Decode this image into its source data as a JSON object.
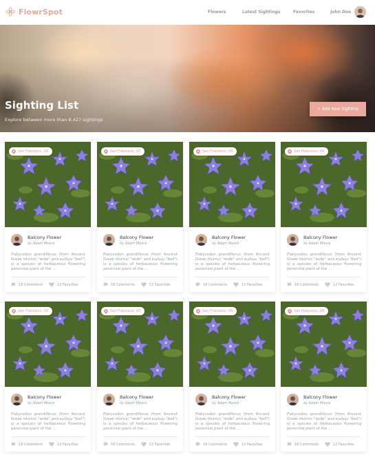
{
  "app": {
    "name": "FlowrSpot",
    "brand_color": "#e8a89a"
  },
  "nav": {
    "flowers": "Flowers",
    "latest_sightings": "Latest Sightings",
    "favorites": "Favorites",
    "user_name": "John Doe"
  },
  "hero": {
    "title": "Sighting List",
    "subtitle": "Explore between more than 8.427 sightings",
    "add_button": "+ Add New Sighting"
  },
  "cards": [
    {
      "location": "San Francisco, US",
      "flower": "Balcony Flower",
      "author": "by Adam Moore",
      "description": "Platycodon grandiflorus (from Ancient Greek πλατύς \"wide\" and κώδων \"bell\") is a species of herbaceous flowering perennial plant of the ...",
      "comments": "18 Comments",
      "favorites": "12 Favorites"
    },
    {
      "location": "San Francisco, US",
      "flower": "Balcony Flower",
      "author": "by Adam Moore",
      "description": "Platycodon grandiflorus (from Ancient Greek πλατύς \"wide\" and κώδων \"bell\") is a species of herbaceous flowering perennial plant of the ...",
      "comments": "18 Comments",
      "favorites": "12 Favorites"
    },
    {
      "location": "San Francisco, US",
      "flower": "Balcony Flower",
      "author": "by Adam Moore",
      "description": "Platycodon grandiflorus (from Ancient Greek πλατύς \"wide\" and κώδων \"bell\") is a species of herbaceous flowering perennial plant of the ...",
      "comments": "18 Comments",
      "favorites": "12 Favorites"
    },
    {
      "location": "San Francisco, US",
      "flower": "Balcony Flower",
      "author": "by Adam Moore",
      "description": "Platycodon grandiflorus (from Ancient Greek πλατύς \"wide\" and κώδων \"bell\") is a species of herbaceous flowering perennial plant of the ...",
      "comments": "18 Comments",
      "favorites": "12 Favorites"
    },
    {
      "location": "San Francisco, US",
      "flower": "Balcony Flower",
      "author": "by Adam Moore",
      "description": "Platycodon grandiflorus (from Ancient Greek πλατύς \"wide\" and κώδων \"bell\") is a species of herbaceous flowering perennial plant of the ...",
      "comments": "18 Comments",
      "favorites": "12 Favorites"
    },
    {
      "location": "San Francisco, US",
      "flower": "Balcony Flower",
      "author": "by Adam Moore",
      "description": "Platycodon grandiflorus (from Ancient Greek πλατύς \"wide\" and κώδων \"bell\") is a species of herbaceous flowering perennial plant of the ...",
      "comments": "18 Comments",
      "favorites": "12 Favorites"
    },
    {
      "location": "San Francisco, US",
      "flower": "Balcony Flower",
      "author": "by Adam Moore",
      "description": "Platycodon grandiflorus (from Ancient Greek πλατύς \"wide\" and κώδων \"bell\") is a species of herbaceous flowering perennial plant of the ...",
      "comments": "18 Comments",
      "favorites": "12 Favorites"
    },
    {
      "location": "San Francisco, US",
      "flower": "Balcony Flower",
      "author": "by Adam Moore",
      "description": "Platycodon grandiflorus (from Ancient Greek πλατύς \"wide\" and κώδων \"bell\") is a species of herbaceous flowering perennial plant of the ...",
      "comments": "18 Comments",
      "favorites": "12 Favorites"
    }
  ]
}
